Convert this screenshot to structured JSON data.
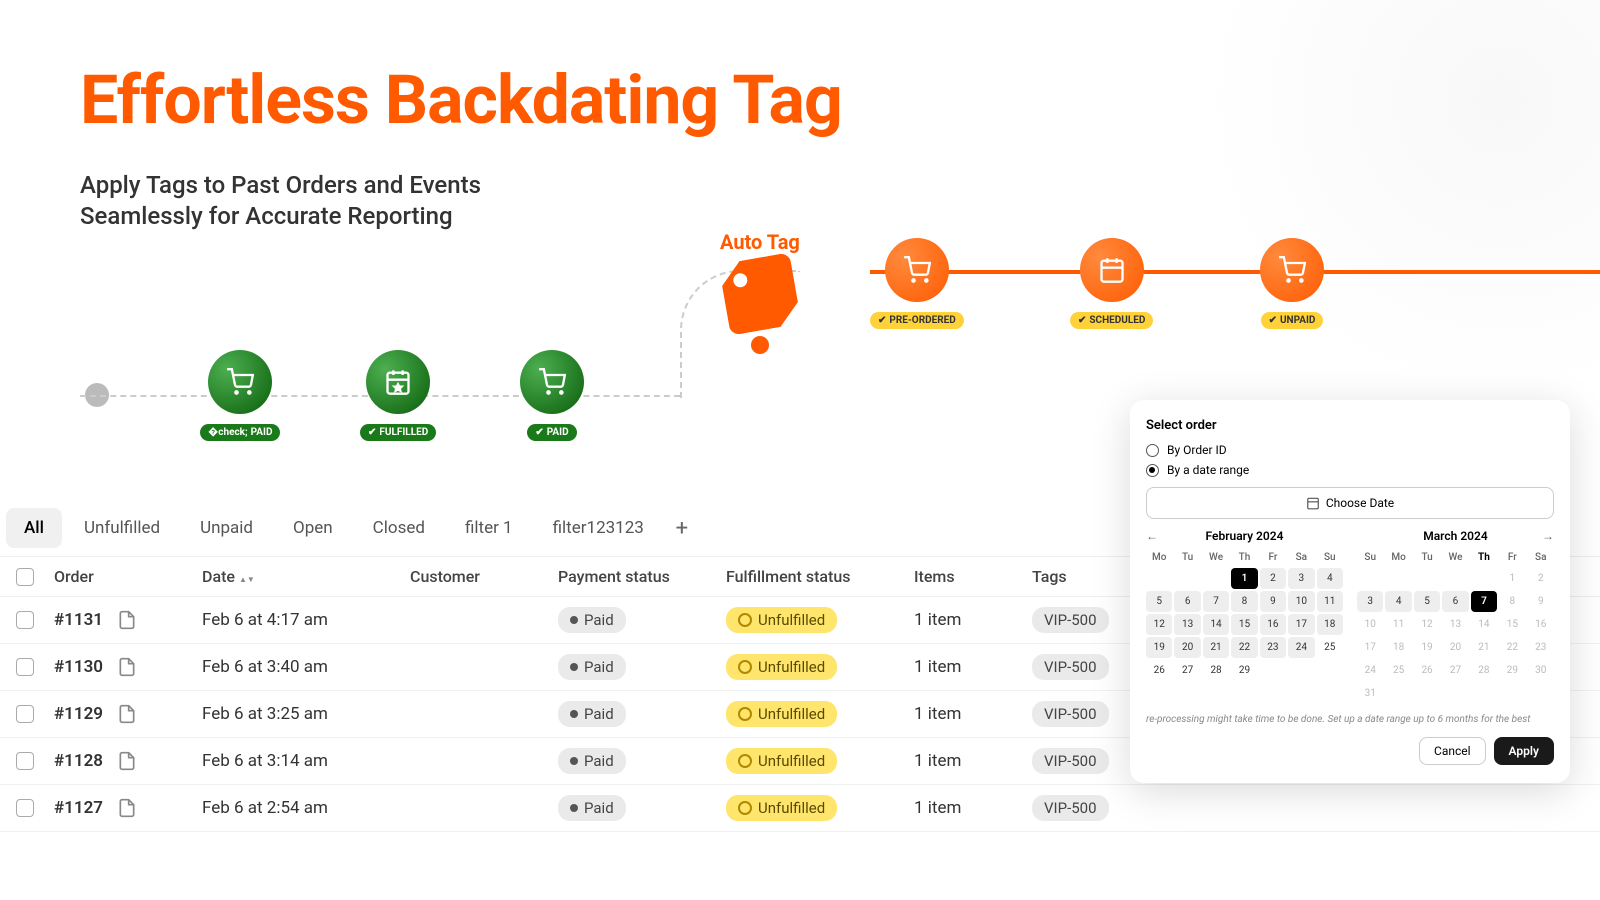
{
  "hero": {
    "title": "Effortless Backdating Tag",
    "subtitle1": "Apply Tags to Past Orders and Events",
    "subtitle2": "Seamlessly for Accurate Reporting"
  },
  "autoTag": {
    "label": "Auto Tag"
  },
  "nodes": {
    "paid": "PAID",
    "fulfilled": "FULFILLED",
    "preordered": "PRE-ORDERED",
    "scheduled": "SCHEDULED",
    "unpaid": "UNPAID"
  },
  "tabs": [
    "All",
    "Unfulfilled",
    "Unpaid",
    "Open",
    "Closed",
    "filter 1",
    "filter123123"
  ],
  "headers": {
    "order": "Order",
    "date": "Date",
    "customer": "Customer",
    "payment": "Payment status",
    "fulfillment": "Fulfillment status",
    "items": "Items",
    "tags": "Tags"
  },
  "rows": [
    {
      "order": "#1131",
      "date": "Feb 6 at 4:17 am",
      "payment": "Paid",
      "fulfillment": "Unfulfilled",
      "items": "1 item",
      "tag": "VIP-500"
    },
    {
      "order": "#1130",
      "date": "Feb 6 at 3:40 am",
      "payment": "Paid",
      "fulfillment": "Unfulfilled",
      "items": "1 item",
      "tag": "VIP-500"
    },
    {
      "order": "#1129",
      "date": "Feb 6 at 3:25 am",
      "payment": "Paid",
      "fulfillment": "Unfulfilled",
      "items": "1 item",
      "tag": "VIP-500"
    },
    {
      "order": "#1128",
      "date": "Feb 6 at 3:14 am",
      "payment": "Paid",
      "fulfillment": "Unfulfilled",
      "items": "1 item",
      "tag": "VIP-500"
    },
    {
      "order": "#1127",
      "date": "Feb 6 at 2:54 am",
      "payment": "Paid",
      "fulfillment": "Unfulfilled",
      "items": "1 item",
      "tag": "VIP-500"
    }
  ],
  "overlay": {
    "title": "Select order",
    "opt1": "By Order ID",
    "opt2": "By a date range",
    "chooseDate": "Choose Date",
    "month1": "February 2024",
    "month2": "March 2024",
    "dows": [
      "Mo",
      "Tu",
      "We",
      "Th",
      "Fr",
      "Sa",
      "Su"
    ],
    "dows2": [
      "Su",
      "Mo",
      "Tu",
      "We",
      "Th",
      "Fr",
      "Sa"
    ],
    "hint": "re-processing might take time to be done. Set up a date range up to 6 months for the best",
    "cancel": "Cancel",
    "apply": "Apply"
  }
}
